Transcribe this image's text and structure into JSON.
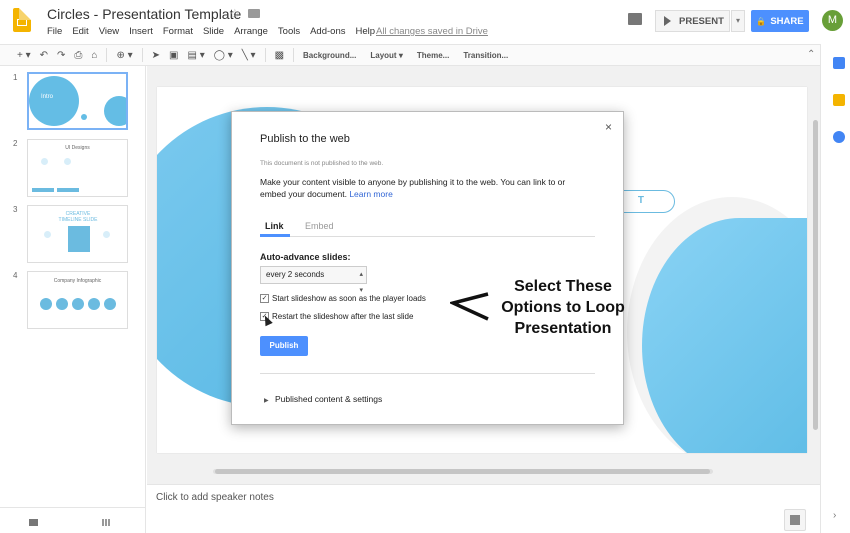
{
  "header": {
    "doc_title": "Circles - Presentation Template",
    "menu": [
      "File",
      "Edit",
      "View",
      "Insert",
      "Format",
      "Slide",
      "Arrange",
      "Tools",
      "Add-ons",
      "Help"
    ],
    "saved_status": "All changes saved in Drive",
    "present_label": "PRESENT",
    "share_label": "SHARE",
    "avatar_initial": "M"
  },
  "toolbar": {
    "background_label": "Background...",
    "layout_label": "Layout",
    "theme_label": "Theme...",
    "transition_label": "Transition..."
  },
  "filmstrip": {
    "slides": [
      {
        "number": "1",
        "title": "Intro"
      },
      {
        "number": "2",
        "title": "UI Designs"
      },
      {
        "number": "3",
        "title": "CREATIVE TIMELINE SLIDE"
      },
      {
        "number": "4",
        "title": "Company Infographic"
      }
    ]
  },
  "slide": {
    "button_text": "T"
  },
  "notes": {
    "placeholder": "Click to add speaker notes"
  },
  "dialog": {
    "title": "Publish to the web",
    "close_glyph": "×",
    "status_note": "This document is not published to the web.",
    "description": "Make your content visible to anyone by publishing it to the web. You can link to or embed your document.",
    "learn_more": "Learn more",
    "tabs": [
      "Link",
      "Embed"
    ],
    "auto_advance_label": "Auto-advance slides:",
    "auto_advance_value": "every 2 seconds",
    "checkbox_start": "Start slideshow as soon as the player loads",
    "checkbox_restart": "Restart the slideshow after the last slide",
    "checkbox_start_checked": true,
    "checkbox_restart_checked": true,
    "publish_label": "Publish",
    "published_settings": "Published content & settings"
  },
  "annotation": {
    "lines": [
      "Select These",
      "Options to Loop",
      "Presentation"
    ]
  },
  "colors": {
    "accent": "#4d90fe",
    "circle": "#64bde5",
    "slides_yellow": "#f4b400"
  }
}
